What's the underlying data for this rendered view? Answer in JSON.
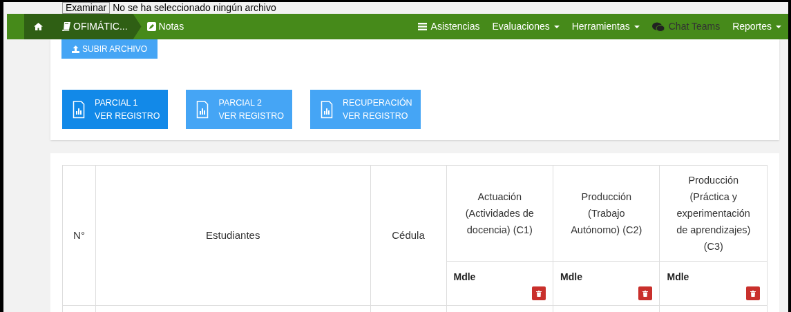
{
  "file_input": {
    "button": "Examinar",
    "status": "No se ha seleccionado ningún archivo"
  },
  "navbar": {
    "breadcrumbs": [
      {
        "kind": "home"
      },
      {
        "kind": "course",
        "label": "OFIMÁTIC..."
      },
      {
        "kind": "notes",
        "label": "Notas"
      }
    ],
    "menu": [
      {
        "kind": "bars",
        "label": "Asistencias",
        "dropdown": false,
        "color": "#ffffff"
      },
      {
        "kind": "plain",
        "label": "Evaluaciones",
        "dropdown": true,
        "color": "#ffffff"
      },
      {
        "kind": "plain",
        "label": "Herramientas",
        "dropdown": true,
        "color": "#ffffff"
      },
      {
        "kind": "chat",
        "label": "Chat Teams",
        "dropdown": false,
        "color": "#333333"
      },
      {
        "kind": "plain",
        "label": "Reportes",
        "dropdown": true,
        "color": "#ffffff"
      }
    ]
  },
  "upload_button": "SUBIR ARCHIVO",
  "register_buttons": [
    {
      "title": "PARCIAL 1",
      "action": "VER REGISTRO",
      "selected": true
    },
    {
      "title": "PARCIAL 2",
      "action": "VER REGISTRO",
      "selected": false
    },
    {
      "title": "RECUPERACIÓN",
      "action": "VER REGISTRO",
      "selected": false
    }
  ],
  "table": {
    "columns": [
      "N°",
      "Estudiantes",
      "Cédula"
    ],
    "criteria": [
      {
        "label": "Actuación (Actividades de docencia) (C1)",
        "sub": "Mdle"
      },
      {
        "label": "Producción (Trabajo Autónomo) (C2)",
        "sub": "Mdle"
      },
      {
        "label": "Producción (Práctica y experimentación de aprendizajes) (C3)",
        "sub": "Mdle"
      }
    ]
  }
}
